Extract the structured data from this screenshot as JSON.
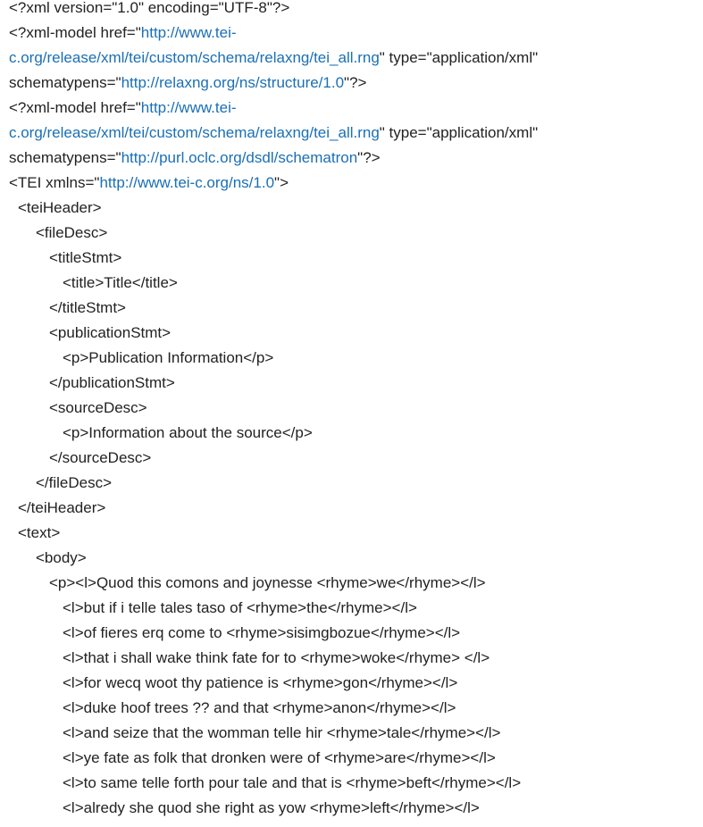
{
  "colors": {
    "text": "#222222",
    "link": "#1a6fb5",
    "background": "#ffffff"
  },
  "lines": [
    {
      "indent": 0,
      "parts": [
        {
          "t": "<?xml version=\"1.0\" encoding=\"UTF-8\"?>"
        }
      ]
    },
    {
      "indent": 0,
      "parts": [
        {
          "t": "<?xml-model href=\""
        },
        {
          "t": "http://www.tei-",
          "link": true
        }
      ]
    },
    {
      "indent": 0,
      "parts": [
        {
          "t": "c.org/release/xml/tei/custom/schema/relaxng/tei_all.rng",
          "link": true
        },
        {
          "t": "\" type=\"application/xml\""
        }
      ]
    },
    {
      "indent": 0,
      "parts": [
        {
          "t": "schematypens=\""
        },
        {
          "t": "http://relaxng.org/ns/structure/1.0",
          "link": true
        },
        {
          "t": "\"?>"
        }
      ]
    },
    {
      "indent": 0,
      "parts": [
        {
          "t": "<?xml-model href=\""
        },
        {
          "t": "http://www.tei-",
          "link": true
        }
      ]
    },
    {
      "indent": 0,
      "parts": [
        {
          "t": "c.org/release/xml/tei/custom/schema/relaxng/tei_all.rng",
          "link": true
        },
        {
          "t": "\" type=\"application/xml\""
        }
      ]
    },
    {
      "indent": 0,
      "parts": [
        {
          "t": "schematypens=\""
        },
        {
          "t": "http://purl.oclc.org/dsdl/schematron",
          "link": true
        },
        {
          "t": "\"?>"
        }
      ]
    },
    {
      "indent": 0,
      "parts": [
        {
          "t": "<TEI xmlns=\""
        },
        {
          "t": "http://www.tei-c.org/ns/1.0",
          "link": true
        },
        {
          "t": "\">"
        }
      ]
    },
    {
      "indent": 1,
      "parts": [
        {
          "t": "<teiHeader>"
        }
      ]
    },
    {
      "indent": 2,
      "parts": [
        {
          "t": "<fileDesc>"
        }
      ]
    },
    {
      "indent": 3,
      "parts": [
        {
          "t": "<titleStmt>"
        }
      ]
    },
    {
      "indent": 4,
      "parts": [
        {
          "t": "<title>Title</title>"
        }
      ]
    },
    {
      "indent": 3,
      "parts": [
        {
          "t": "</titleStmt>"
        }
      ]
    },
    {
      "indent": 3,
      "parts": [
        {
          "t": "<publicationStmt>"
        }
      ]
    },
    {
      "indent": 4,
      "parts": [
        {
          "t": "<p>Publication Information</p>"
        }
      ]
    },
    {
      "indent": 3,
      "parts": [
        {
          "t": "</publicationStmt>"
        }
      ]
    },
    {
      "indent": 3,
      "parts": [
        {
          "t": "<sourceDesc>"
        }
      ]
    },
    {
      "indent": 4,
      "parts": [
        {
          "t": "<p>Information about the source</p>"
        }
      ]
    },
    {
      "indent": 3,
      "parts": [
        {
          "t": "</sourceDesc>"
        }
      ]
    },
    {
      "indent": 2,
      "parts": [
        {
          "t": "</fileDesc>"
        }
      ]
    },
    {
      "indent": 1,
      "parts": [
        {
          "t": "</teiHeader>"
        }
      ]
    },
    {
      "indent": 1,
      "parts": [
        {
          "t": "<text>"
        }
      ]
    },
    {
      "indent": 2,
      "parts": [
        {
          "t": "<body>"
        }
      ]
    },
    {
      "indent": 3,
      "parts": [
        {
          "t": "<p><l>Quod this comons and joynesse <rhyme>we</rhyme></l>"
        }
      ]
    },
    {
      "indent": 4,
      "parts": [
        {
          "t": "<l>but if i telle tales taso of <rhyme>the</rhyme></l>"
        }
      ]
    },
    {
      "indent": 4,
      "parts": [
        {
          "t": "<l>of fieres erq come to <rhyme>sisimgbozue</rhyme></l>"
        }
      ]
    },
    {
      "indent": 4,
      "parts": [
        {
          "t": "<l>that i shall wake think fate for to <rhyme>woke</rhyme> </l>"
        }
      ]
    },
    {
      "indent": 4,
      "parts": [
        {
          "t": "<l>for wecq woot thy patience is <rhyme>gon</rhyme></l>"
        }
      ]
    },
    {
      "indent": 4,
      "parts": [
        {
          "t": "<l>duke hoof trees ?? and that <rhyme>anon</rhyme></l>"
        }
      ]
    },
    {
      "indent": 4,
      "parts": [
        {
          "t": "<l>and seize that the womman telle hir <rhyme>tale</rhyme></l>"
        }
      ]
    },
    {
      "indent": 4,
      "parts": [
        {
          "t": "<l>ye fate as folk that dronken were of <rhyme>are</rhyme></l>"
        }
      ]
    },
    {
      "indent": 4,
      "parts": [
        {
          "t": "<l>to same telle forth pour tale and that is <rhyme>beft</rhyme></l>"
        }
      ]
    },
    {
      "indent": 4,
      "parts": [
        {
          "t": "<l>alredy she quod she right as yow <rhyme>left</rhyme></l>"
        }
      ]
    }
  ]
}
